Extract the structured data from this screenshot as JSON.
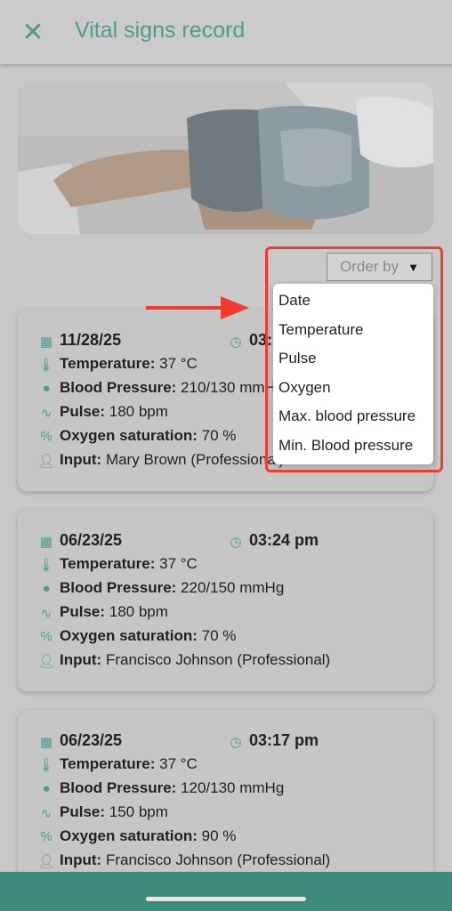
{
  "header": {
    "title": "Vital signs record",
    "close_icon": "close-icon"
  },
  "order_by": {
    "label": "Order by",
    "options": [
      "Date",
      "Temperature",
      "Pulse",
      "Oxygen",
      "Max. blood pressure",
      "Min. Blood pressure"
    ]
  },
  "labels": {
    "temperature": "Temperature:",
    "blood_pressure": "Blood Pressure:",
    "pulse": "Pulse:",
    "oxygen": "Oxygen saturation:",
    "input": "Input:"
  },
  "records": [
    {
      "date": "11/28/25",
      "time": "03:",
      "temperature": "37 °C",
      "blood_pressure": "210/130 mmHg",
      "pulse": "180 bpm",
      "oxygen": "70 %",
      "input": "Mary  Brown (Professional)"
    },
    {
      "date": "06/23/25",
      "time": "03:24 pm",
      "temperature": "37 °C",
      "blood_pressure": "220/150 mmHg",
      "pulse": "180 bpm",
      "oxygen": "70 %",
      "input": "Francisco Johnson (Professional)"
    },
    {
      "date": "06/23/25",
      "time": "03:17 pm",
      "temperature": "37 °C",
      "blood_pressure": "120/130 mmHg",
      "pulse": "150 bpm",
      "oxygen": "90 %",
      "input": "Francisco Johnson (Professional)"
    }
  ],
  "colors": {
    "accent": "#4f9b8f",
    "bottom_bar": "#3d8b7b",
    "highlight": "#ef3b30"
  }
}
